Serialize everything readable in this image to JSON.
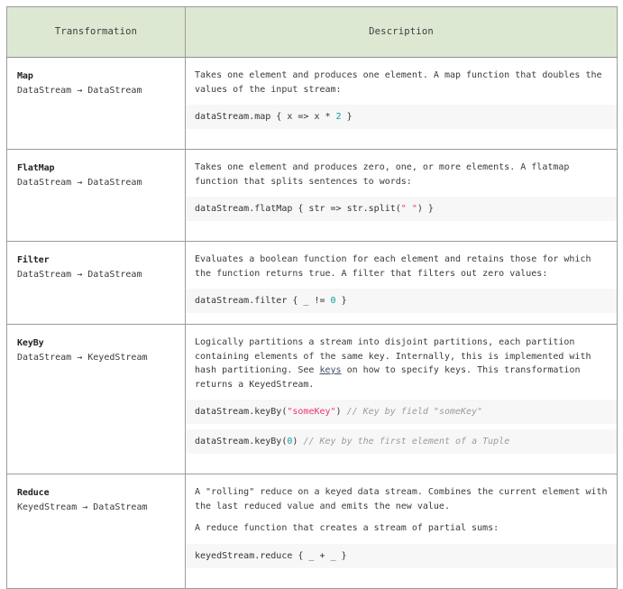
{
  "table": {
    "headers": {
      "transformation": "Transformation",
      "description": "Description"
    },
    "colors": {
      "header_bg": "#dde8d3",
      "border": "#9c9c9c",
      "code_bg": "#f7f7f7",
      "number_token": "#0a9ea5",
      "string_token": "#e8386b",
      "comment_token": "#9b9b9b",
      "link": "#3d4f63"
    },
    "rows": [
      {
        "name": "Map",
        "signature": "DataStream → DataStream",
        "paragraphs": [
          "Takes one element and produces one element. A map function that doubles the values of the input stream:"
        ],
        "code": [
          {
            "prefix": "dataStream.map { x => x * ",
            "number": "2",
            "suffix": " }"
          }
        ]
      },
      {
        "name": "FlatMap",
        "signature": "DataStream → DataStream",
        "paragraphs": [
          "Takes one element and produces zero, one, or more elements. A flatmap function that splits sentences to words:"
        ],
        "code": [
          {
            "prefix": "dataStream.flatMap { str => str.split(",
            "string": "\" \"",
            "suffix": ") }"
          }
        ]
      },
      {
        "name": "Filter",
        "signature": "DataStream → DataStream",
        "paragraphs": [
          "Evaluates a boolean function for each element and retains those for which the function returns true. A filter that filters out zero values:"
        ],
        "code": [
          {
            "prefix": "dataStream.filter { _ != ",
            "number": "0",
            "suffix": " }"
          }
        ]
      },
      {
        "name": "KeyBy",
        "signature": "DataStream → KeyedStream",
        "paragraphs_rich": {
          "part1": "Logically partitions a stream into disjoint partitions, each partition containing elements of the same key. Internally, this is implemented with hash partitioning. See ",
          "link": "keys",
          "part2": " on how to specify keys. This transformation returns a KeyedStream."
        },
        "code": [
          {
            "prefix": "dataStream.keyBy(",
            "string": "\"someKey\"",
            "suffix": ") ",
            "comment": "// Key by field \"someKey\""
          },
          {
            "prefix": "dataStream.keyBy(",
            "number": "0",
            "suffix": ") ",
            "comment": "// Key by the first element of a Tuple"
          }
        ]
      },
      {
        "name": "Reduce",
        "signature": "KeyedStream → DataStream",
        "paragraphs": [
          "A \"rolling\" reduce on a keyed data stream. Combines the current element with the last reduced value and emits the new value.",
          "A reduce function that creates a stream of partial sums:"
        ],
        "code": [
          {
            "prefix": "keyedStream.reduce { _ + _ }"
          }
        ]
      }
    ]
  }
}
